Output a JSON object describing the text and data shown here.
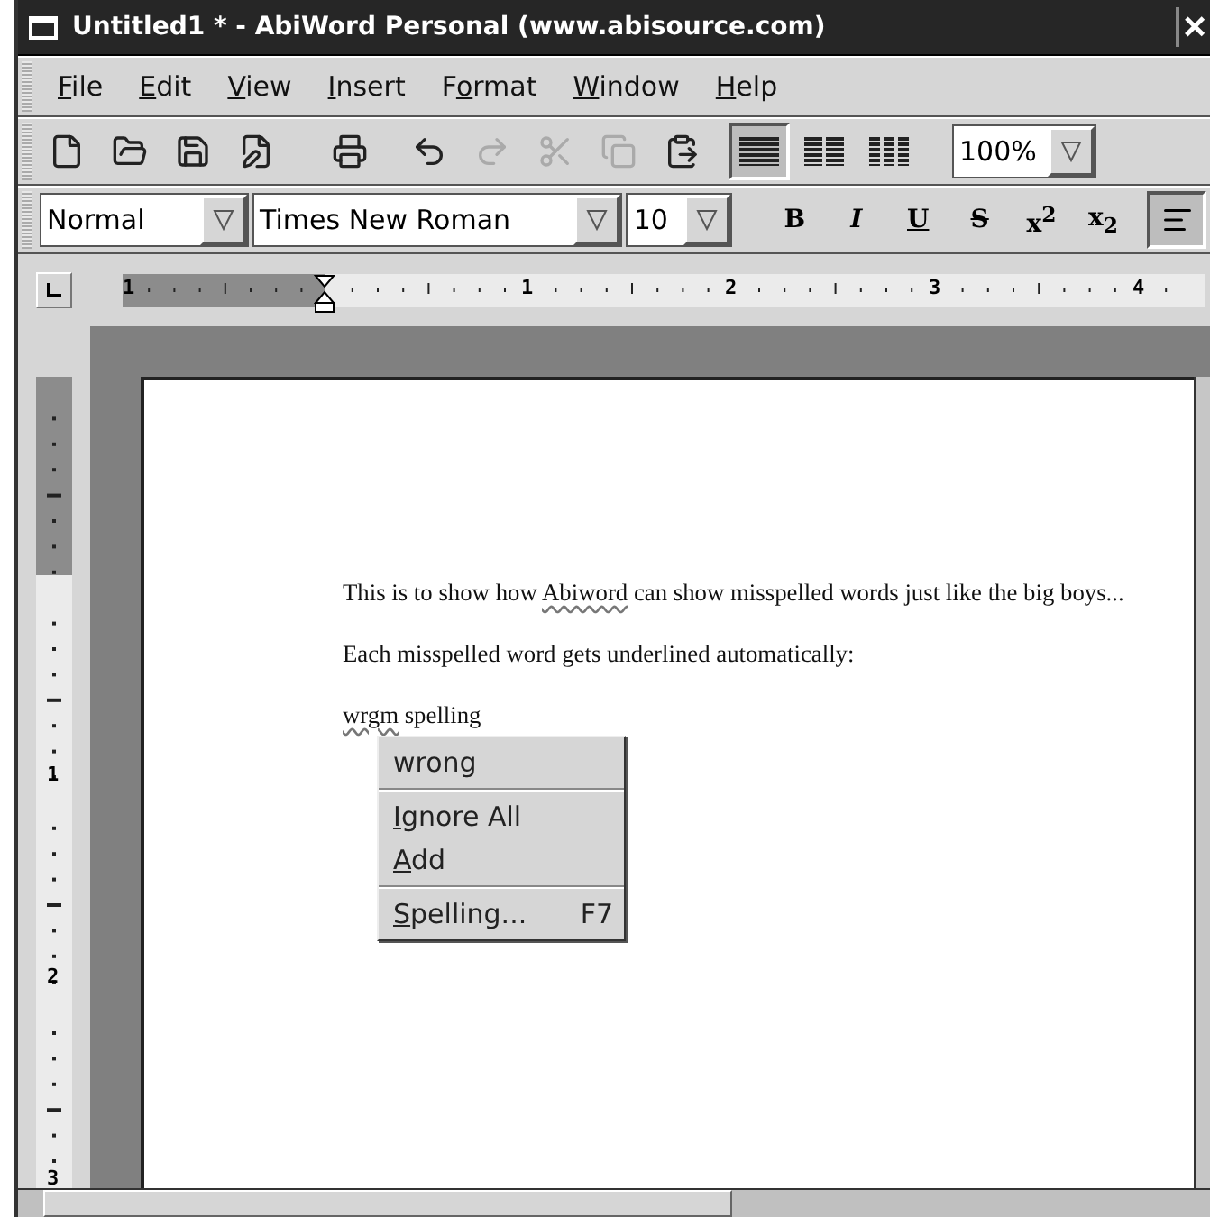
{
  "window": {
    "title": "Untitled1 * - AbiWord Personal (www.abisource.com)",
    "close": "×"
  },
  "menu": [
    {
      "key": "F",
      "post": "ile"
    },
    {
      "key": "E",
      "post": "dit"
    },
    {
      "key": "V",
      "post": "iew"
    },
    {
      "key": "I",
      "post": "nsert"
    },
    {
      "pre": "F",
      "key": "o",
      "post": "rmat"
    },
    {
      "key": "W",
      "post": "indow"
    },
    {
      "key": "H",
      "post": "elp"
    }
  ],
  "toolbar": [
    {
      "kind": "new",
      "disabled": false
    },
    {
      "kind": "open",
      "disabled": false
    },
    {
      "kind": "save",
      "disabled": false
    },
    {
      "kind": "edit",
      "disabled": false
    },
    {
      "kind": "print",
      "disabled": false
    },
    {
      "kind": "undo",
      "disabled": false
    },
    {
      "kind": "redo",
      "disabled": true
    },
    {
      "kind": "cut",
      "disabled": true
    },
    {
      "kind": "copy",
      "disabled": true
    },
    {
      "kind": "paste",
      "disabled": false
    }
  ],
  "columns": [
    {
      "kind": "one",
      "selected": true
    },
    {
      "kind": "two",
      "selected": false
    },
    {
      "kind": "three",
      "selected": false
    }
  ],
  "zoom": {
    "value": "100%"
  },
  "style": {
    "value": "Normal"
  },
  "font": {
    "value": "Times New Roman"
  },
  "size": {
    "value": "10"
  },
  "format_buttons": [
    {
      "label": "B",
      "kind": "bold"
    },
    {
      "label": "I",
      "kind": "italic"
    },
    {
      "label": "U",
      "kind": "underline"
    },
    {
      "label": "S",
      "kind": "strike"
    },
    {
      "label": "x$^{2}$",
      "kind": "superscript"
    },
    {
      "label": "x$_{2}$",
      "kind": "subscript"
    }
  ],
  "align": {
    "selected": true
  },
  "ruler": {
    "labels": [
      "1",
      "1",
      "2",
      "3",
      "4"
    ]
  },
  "vruler": {
    "labels": [
      "1",
      "2",
      "3"
    ]
  },
  "paragraphs": [
    [
      {
        "text": "This is to show how ",
        "misspelled": false
      },
      {
        "text": "Abiword",
        "misspelled": true
      },
      {
        "text": " can show misspelled words just like the big boys...",
        "misspelled": false
      }
    ],
    [
      {
        "text": "Each misspelled word gets underlined automatically:",
        "misspelled": false
      }
    ],
    [
      {
        "text": "wrgm",
        "misspelled": true
      },
      {
        "text": " spelling",
        "misspelled": false
      }
    ]
  ],
  "context_menu": [
    {
      "kind": "suggestion",
      "label": "wrong"
    },
    {
      "kind": "separator"
    },
    {
      "kind": "item",
      "key": "I",
      "post": "gnore All"
    },
    {
      "kind": "item",
      "key": "A",
      "post": "dd"
    },
    {
      "kind": "separator"
    },
    {
      "kind": "item",
      "key": "S",
      "post": "pelling...",
      "shortcut": "F7"
    }
  ]
}
